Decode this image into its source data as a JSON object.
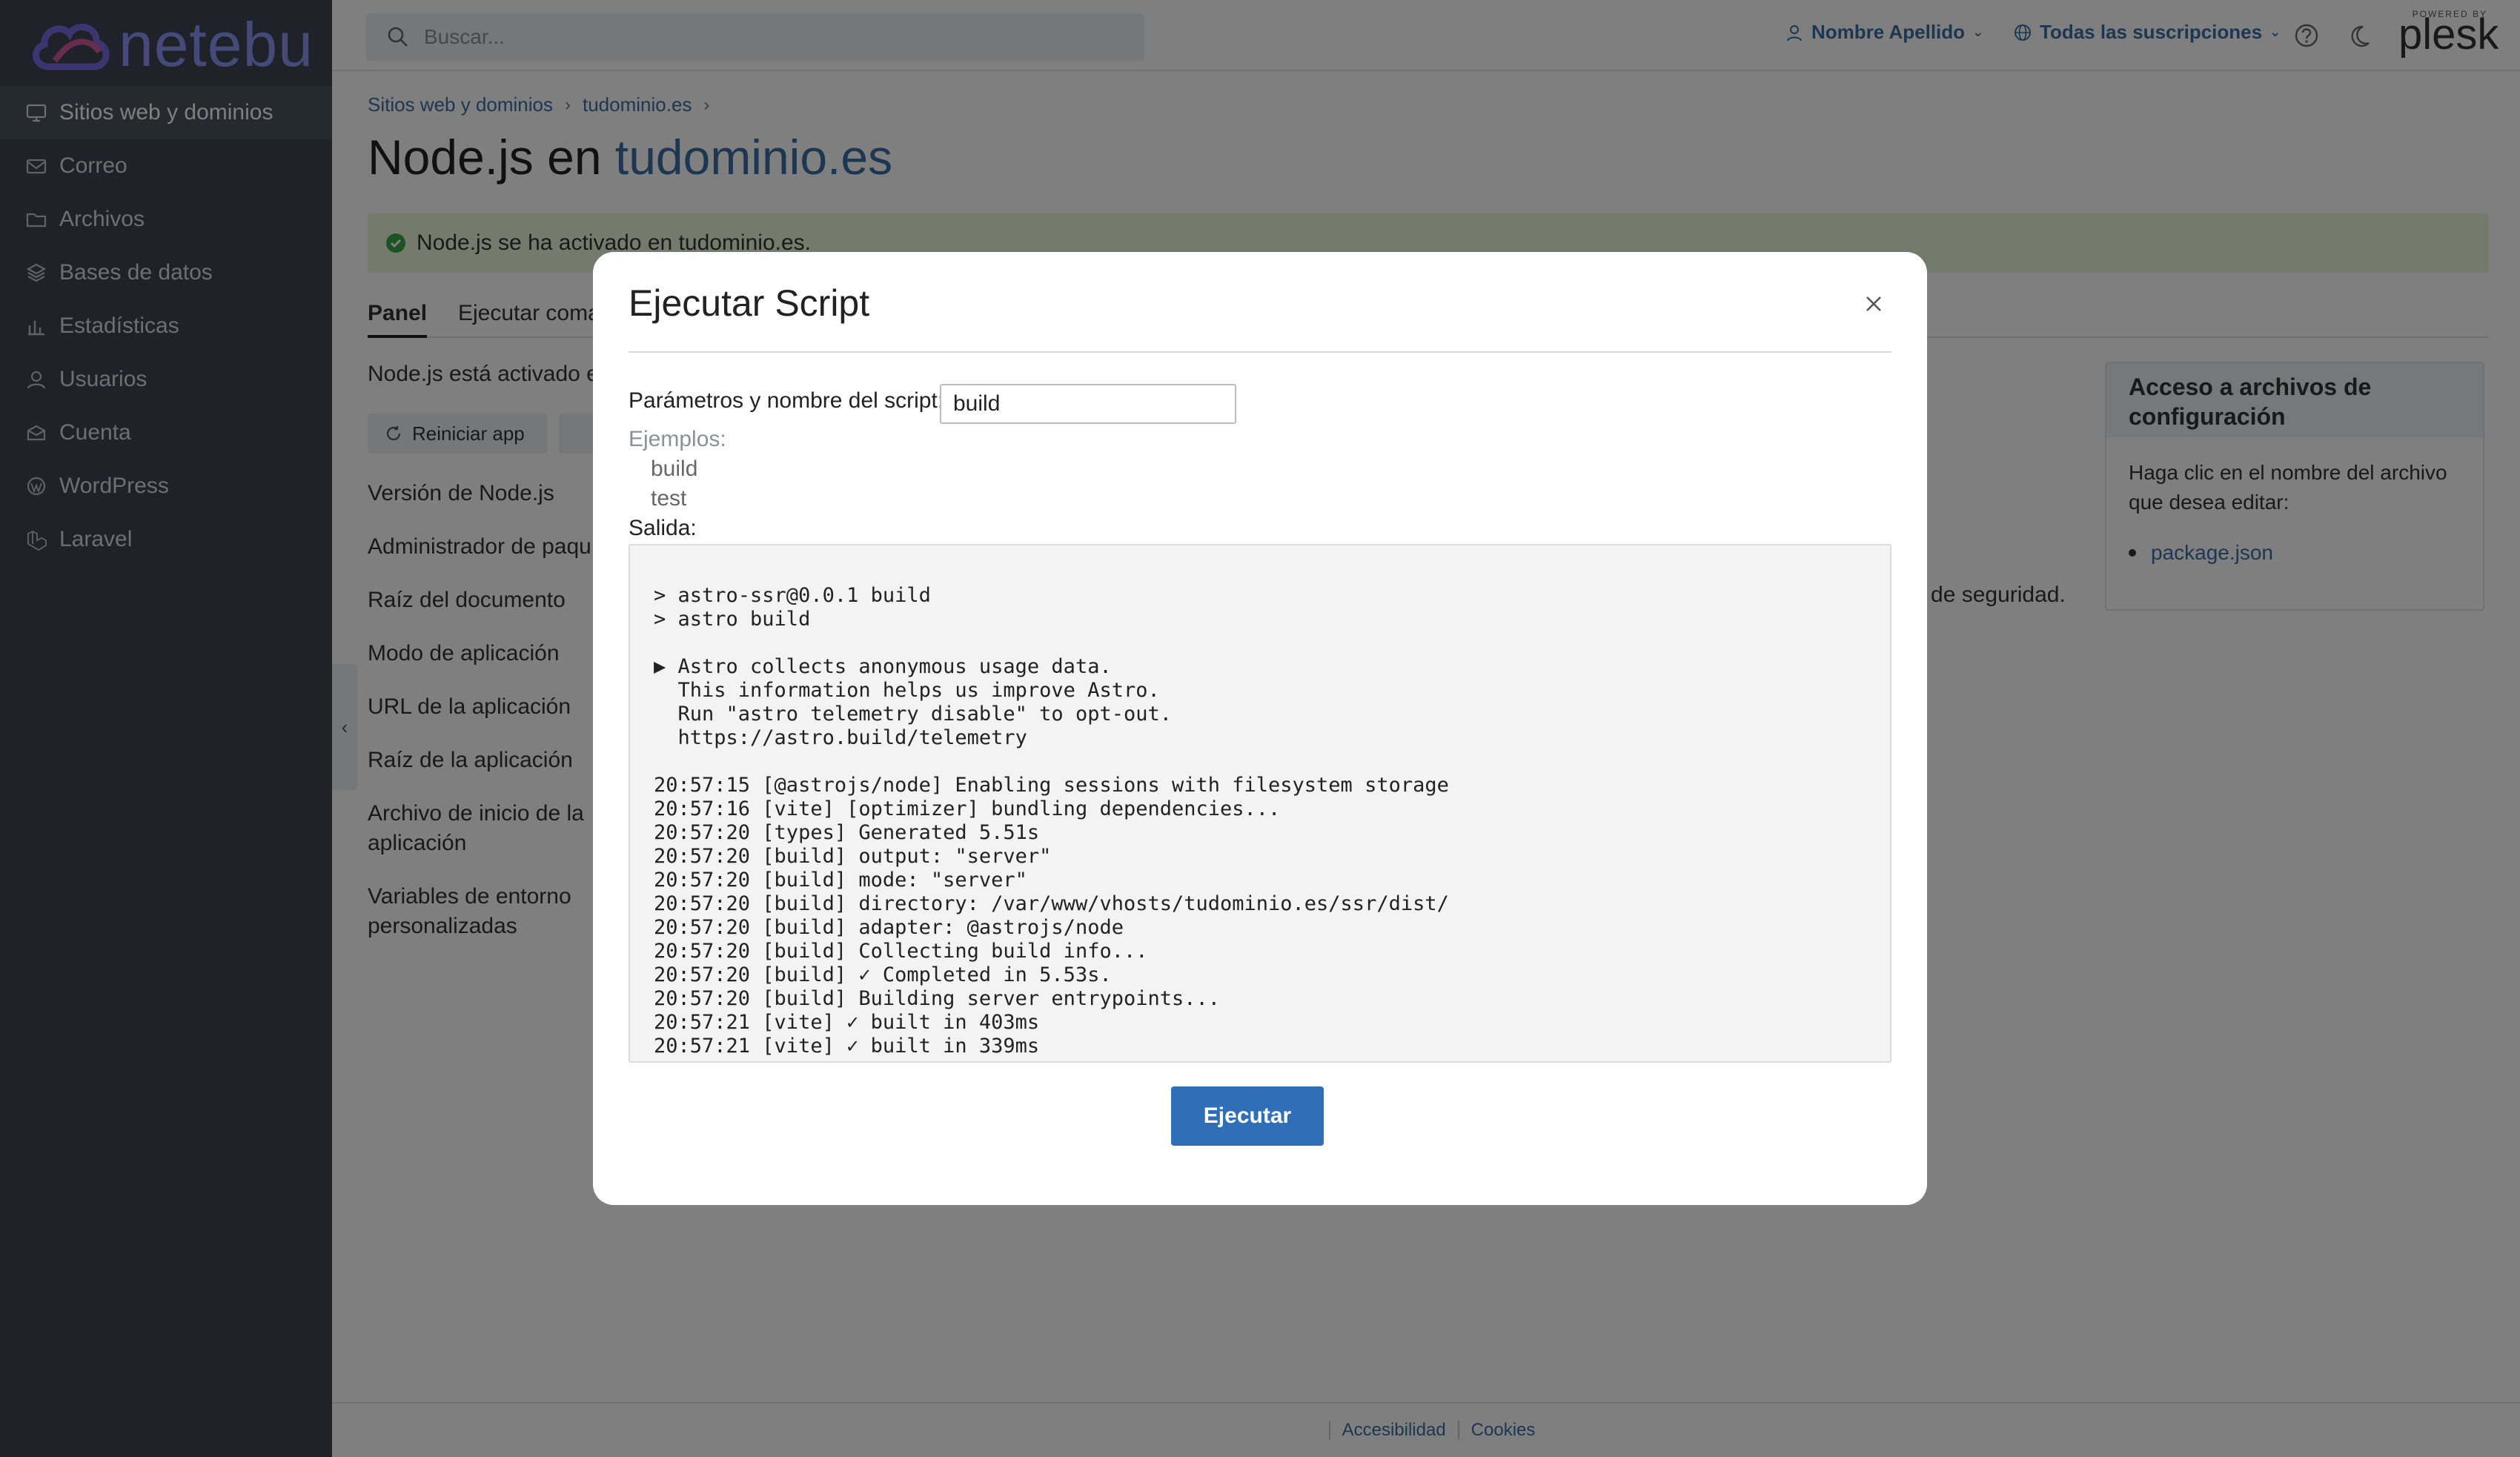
{
  "brand": {
    "logo_text": "netebu"
  },
  "sidebar": {
    "items": [
      {
        "label": "Sitios web y dominios",
        "icon": "monitor-icon",
        "active": true
      },
      {
        "label": "Correo",
        "icon": "mail-icon"
      },
      {
        "label": "Archivos",
        "icon": "folder-icon"
      },
      {
        "label": "Bases de datos",
        "icon": "database-icon"
      },
      {
        "label": "Estadísticas",
        "icon": "chart-icon"
      },
      {
        "label": "Usuarios",
        "icon": "user-icon"
      },
      {
        "label": "Cuenta",
        "icon": "account-icon"
      },
      {
        "label": "WordPress",
        "icon": "wordpress-icon"
      },
      {
        "label": "Laravel",
        "icon": "laravel-icon"
      }
    ]
  },
  "topbar": {
    "search_placeholder": "Buscar...",
    "user_name": "Nombre Apellido",
    "subscriptions": "Todas las suscripciones",
    "powered_by": "POWERED BY",
    "plesk": "plesk"
  },
  "breadcrumb": {
    "items": [
      "Sitios web y dominios",
      "tudominio.es"
    ]
  },
  "page": {
    "title_prefix": "Node.js en",
    "title_domain": "tudominio.es",
    "alert": "Node.js se ha activado en tudominio.es.",
    "tabs": [
      "Panel",
      "Ejecutar coma"
    ],
    "status_text": "Node.js está activado e",
    "buttons": {
      "restart": "Reiniciar app"
    },
    "info_labels": [
      "Versión de Node.js",
      "Administrador de paqu",
      "Raíz del documento",
      "Modo de aplicación",
      "URL de la aplicación",
      "Raíz de la aplicación",
      "Archivo de inicio de la",
      "aplicación",
      "Variables de entorno",
      "personalizadas"
    ],
    "info_trailing": "vos de seguridad."
  },
  "side_panel": {
    "title": "Acceso a archivos de configuración",
    "body": "Haga clic en el nombre del archivo que desea editar:",
    "link": "package.json"
  },
  "footer": {
    "accessibility": "Accesibilidad",
    "cookies": "Cookies"
  },
  "modal": {
    "title": "Ejecutar Script",
    "field_label": "Parámetros y nombre del script:",
    "field_value": "build",
    "examples_label": "Ejemplos:",
    "examples": [
      "build",
      "test"
    ],
    "output_label": "Salida:",
    "output_lines": [
      "> astro-ssr@0.0.1 build",
      "> astro build",
      "",
      "▶ Astro collects anonymous usage data.",
      "  This information helps us improve Astro.",
      "  Run \"astro telemetry disable\" to opt-out.",
      "  https://astro.build/telemetry",
      "",
      "20:57:15 [@astrojs/node] Enabling sessions with filesystem storage",
      "20:57:16 [vite] [optimizer] bundling dependencies...",
      "20:57:20 [types] Generated 5.51s",
      "20:57:20 [build] output: \"server\"",
      "20:57:20 [build] mode: \"server\"",
      "20:57:20 [build] directory: /var/www/vhosts/tudominio.es/ssr/dist/",
      "20:57:20 [build] adapter: @astrojs/node",
      "20:57:20 [build] Collecting build info...",
      "20:57:20 [build] ✓ Completed in 5.53s.",
      "20:57:20 [build] Building server entrypoints...",
      "20:57:21 [vite] ✓ built in 403ms",
      "20:57:21 [vite] ✓ built in 339ms"
    ],
    "run_button": "Ejecutar"
  },
  "colors": {
    "sidebar_bg": "#3f4653",
    "link": "#3a6ea5",
    "primary_button": "#2f6fb8",
    "alert_bg": "#e9f7d9",
    "success": "#3aa54a"
  }
}
